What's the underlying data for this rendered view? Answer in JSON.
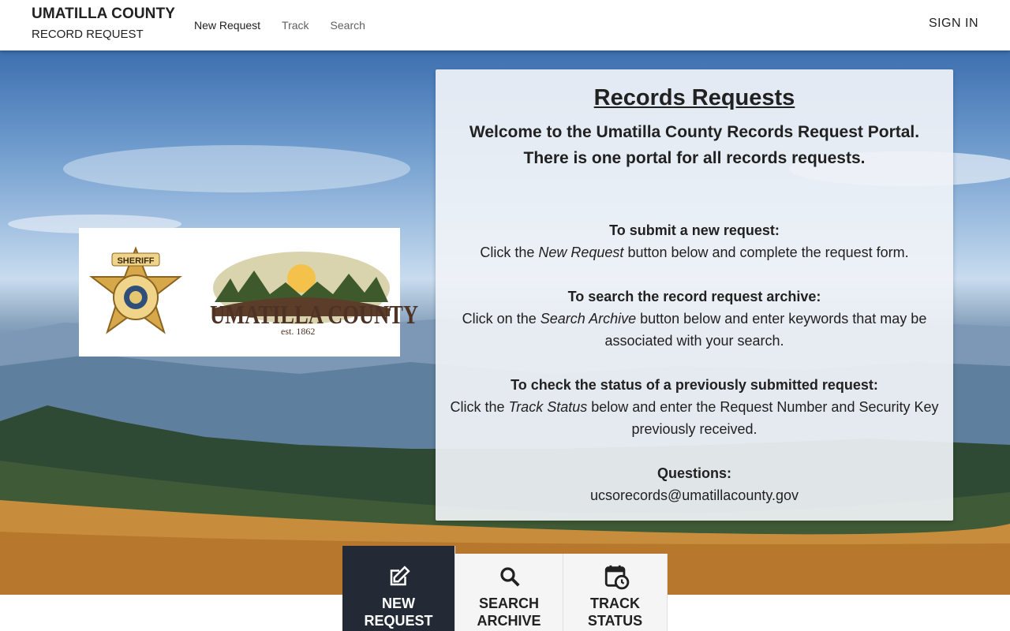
{
  "header": {
    "brand_title": "UMATILLA COUNTY",
    "brand_subtitle": "RECORD REQUEST",
    "nav": [
      {
        "label": "New Request",
        "active": true
      },
      {
        "label": "Track",
        "active": false
      },
      {
        "label": "Search",
        "active": false
      }
    ],
    "sign_in": "SIGN IN"
  },
  "logos": {
    "badge_text": "SHERIFF",
    "county_name": "UMATILLA COUNTY",
    "established": "est. 1862"
  },
  "info": {
    "title": "Records Requests",
    "welcome_line1": "Welcome to the Umatilla County Records Request Portal.",
    "welcome_line2": "There is one portal for all records requests.",
    "new_request": {
      "heading": "To submit a new request:",
      "pre": "Click the ",
      "em": "New Request",
      "post": " button below and complete the request form."
    },
    "search": {
      "heading": "To search the record request archive:",
      "pre": "Click on the ",
      "em": "Search Archive",
      "post": " button below and enter keywords that may be associated with your search."
    },
    "status": {
      "heading": "To check the status of a previously submitted request:",
      "pre": "Click the ",
      "em": "Track Status",
      "post": " below and enter the Request Number and Security Key previously received."
    },
    "questions": {
      "heading": "Questions:",
      "email": "ucsorecords@umatillacounty.gov"
    }
  },
  "actions": [
    {
      "line1": "NEW",
      "line2": "REQUEST",
      "icon": "edit-icon",
      "active": true
    },
    {
      "line1": "SEARCH",
      "line2": "ARCHIVE",
      "icon": "search-icon",
      "active": false
    },
    {
      "line1": "TRACK",
      "line2": "STATUS",
      "icon": "calendar-clock-icon",
      "active": false
    }
  ],
  "colors": {
    "active_tab": "#232a35",
    "inactive_tab": "#f5f5f5",
    "text": "#212121"
  }
}
